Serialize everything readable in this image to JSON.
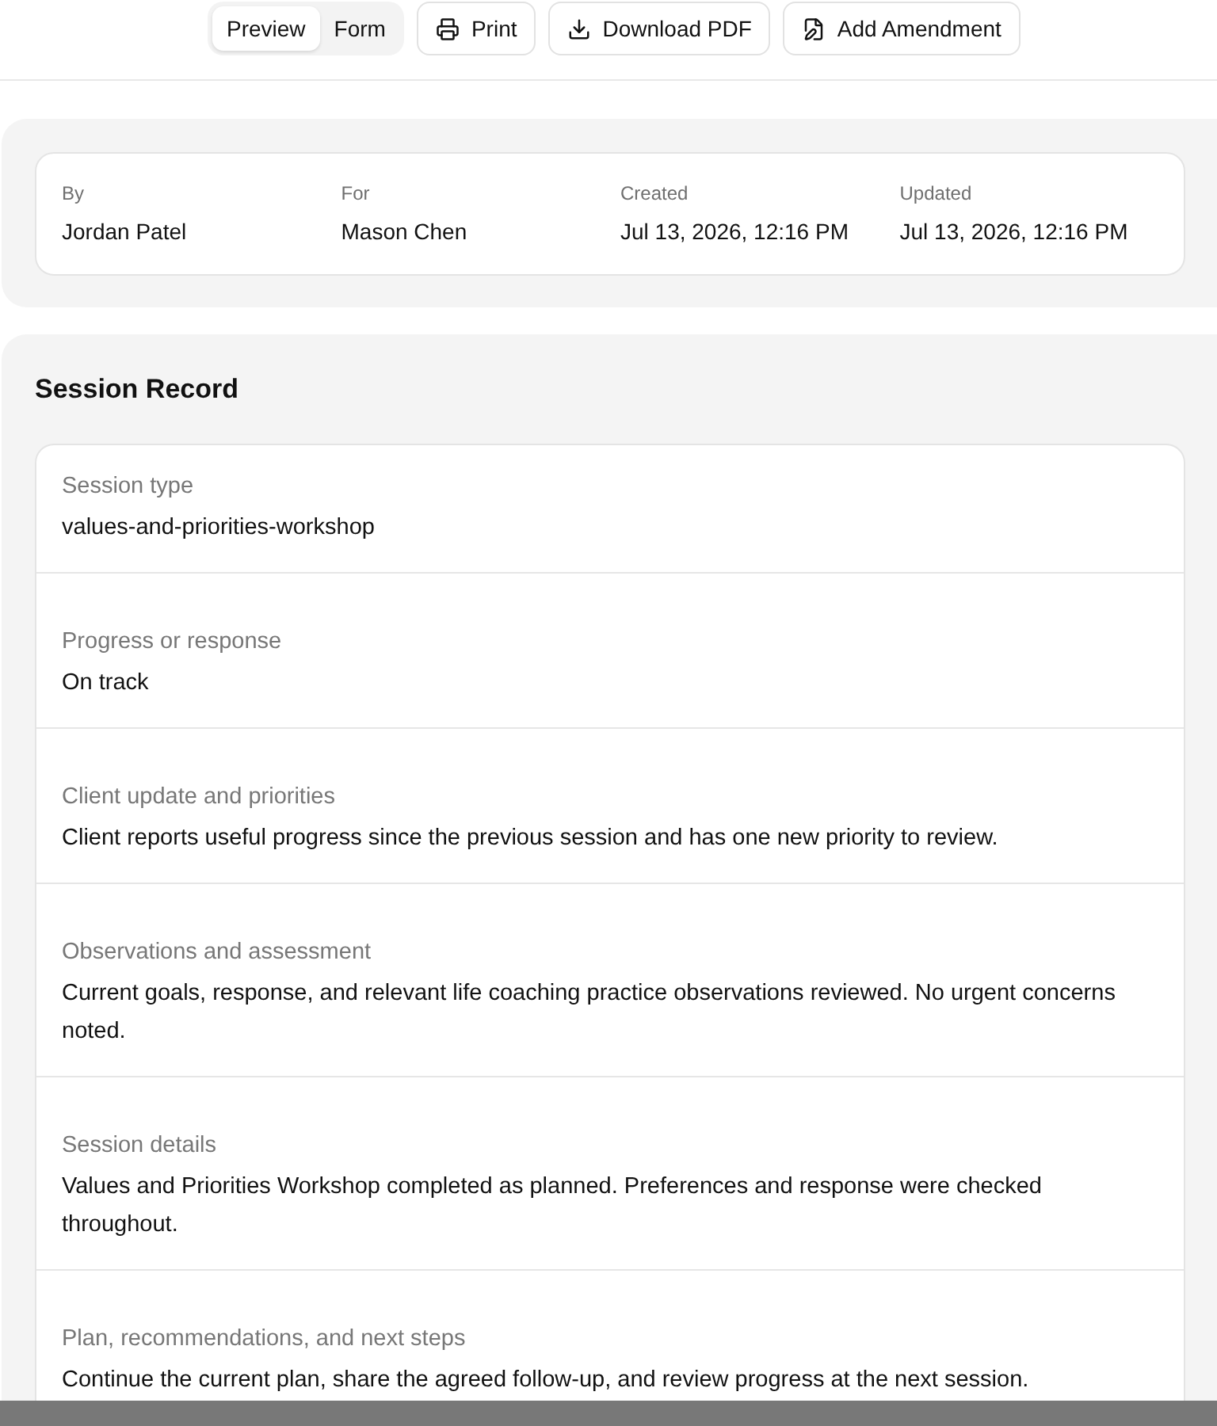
{
  "toolbar": {
    "view_toggle": [
      {
        "label": "Preview",
        "selected": true
      },
      {
        "label": "Form",
        "selected": false
      }
    ],
    "buttons": [
      {
        "label": "Print",
        "kind": "print"
      },
      {
        "label": "Download PDF",
        "kind": "download"
      },
      {
        "label": "Add Amendment",
        "kind": "amend"
      }
    ]
  },
  "meta": [
    {
      "label": "By",
      "value": "Jordan Patel"
    },
    {
      "label": "For",
      "value": "Mason Chen"
    },
    {
      "label": "Created",
      "value": "Jul 13, 2026, 12:16 PM"
    },
    {
      "label": "Updated",
      "value": "Jul 13, 2026, 12:16 PM"
    }
  ],
  "session_record": {
    "title": "Session Record",
    "fields": [
      {
        "label": "Session type",
        "value": "values-and-priorities-workshop"
      },
      {
        "label": "Progress or response",
        "value": "On track"
      },
      {
        "label": "Client update and priorities",
        "value": "Client reports useful progress since the previous session and has one new priority to review."
      },
      {
        "label": "Observations and assessment",
        "value": "Current goals, response, and relevant life coaching practice observations reviewed. No urgent concerns noted."
      },
      {
        "label": "Session details",
        "value": "Values and Priorities Workshop completed as planned. Preferences and response were checked throughout."
      },
      {
        "label": "Plan, recommendations, and next steps",
        "value": "Continue the current plan, share the agreed follow-up, and review progress at the next session."
      }
    ]
  }
}
